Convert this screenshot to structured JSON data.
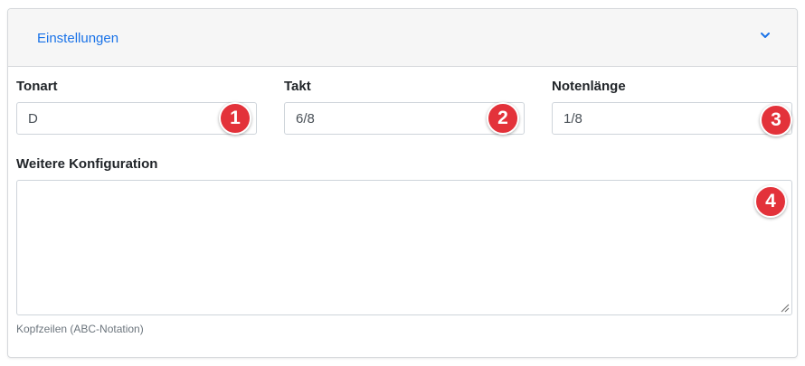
{
  "header": {
    "title": "Einstellungen",
    "toggle_icon": "chevron-down-icon"
  },
  "fields": {
    "tonart": {
      "label": "Tonart",
      "value": "D",
      "badge": "1"
    },
    "takt": {
      "label": "Takt",
      "value": "6/8",
      "badge": "2"
    },
    "notenlaenge": {
      "label": "Notenlänge",
      "value": "1/8",
      "badge": "3"
    }
  },
  "config": {
    "label": "Weitere Konfiguration",
    "value": "",
    "badge": "4",
    "help": "Kopfzeilen (ABC-Notation)"
  },
  "colors": {
    "accent": "#1a73e8",
    "badge": "#e3323a",
    "border": "#ced4da"
  }
}
